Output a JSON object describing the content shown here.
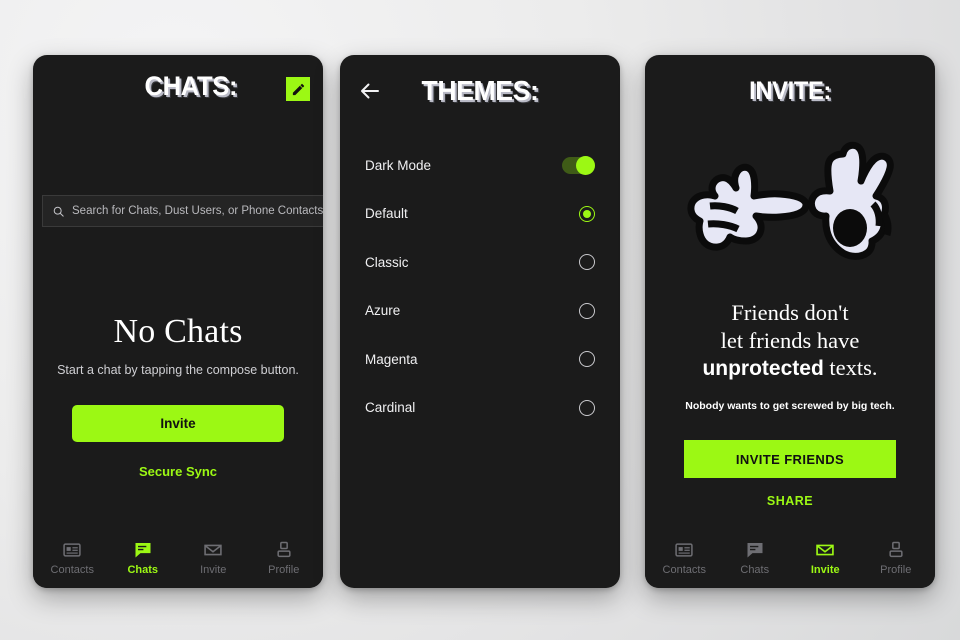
{
  "colors": {
    "accent": "#9cf814",
    "panel_bg": "#1b1b1b",
    "page_bg": "#ececec",
    "text": "#ffffff",
    "muted": "#6e6e73"
  },
  "chats_screen": {
    "title": "CHATS:",
    "compose_icon": "pencil-icon",
    "search": {
      "placeholder": "Search for Chats, Dust Users, or Phone Contacts",
      "value": "",
      "icon": "search-icon"
    },
    "empty_state": {
      "heading": "No Chats",
      "description": "Start a chat by tapping the compose button.",
      "primary_button": "Invite",
      "secondary_link": "Secure Sync"
    },
    "nav": [
      {
        "label": "Contacts",
        "icon": "contact-card-icon",
        "active": false
      },
      {
        "label": "Chats",
        "icon": "chat-bubble-icon",
        "active": true
      },
      {
        "label": "Invite",
        "icon": "envelope-icon",
        "active": false
      },
      {
        "label": "Profile",
        "icon": "person-icon",
        "active": false
      }
    ]
  },
  "themes_screen": {
    "title": "THEMES:",
    "back_icon": "arrow-left-icon",
    "rows": [
      {
        "label": "Dark Mode",
        "control": "toggle",
        "on": true
      },
      {
        "label": "Default",
        "control": "radio",
        "on": true
      },
      {
        "label": "Classic",
        "control": "radio",
        "on": false
      },
      {
        "label": "Azure",
        "control": "radio",
        "on": false
      },
      {
        "label": "Magenta",
        "control": "radio",
        "on": false
      },
      {
        "label": "Cardinal",
        "control": "radio",
        "on": false
      }
    ]
  },
  "invite_screen": {
    "title": "INVITE:",
    "illustration": "cartoon-hands-pointing-ok-icon",
    "tagline_line1": "Friends don't",
    "tagline_line2": "let friends have",
    "tagline_bold": "unprotected",
    "tagline_tail": " texts.",
    "subline": "Nobody wants to get screwed by big tech.",
    "primary_button": "INVITE FRIENDS",
    "share_link": "SHARE",
    "nav": [
      {
        "label": "Contacts",
        "icon": "contact-card-icon",
        "active": false
      },
      {
        "label": "Chats",
        "icon": "chat-bubble-icon",
        "active": false
      },
      {
        "label": "Invite",
        "icon": "envelope-icon",
        "active": true
      },
      {
        "label": "Profile",
        "icon": "person-icon",
        "active": false
      }
    ]
  }
}
